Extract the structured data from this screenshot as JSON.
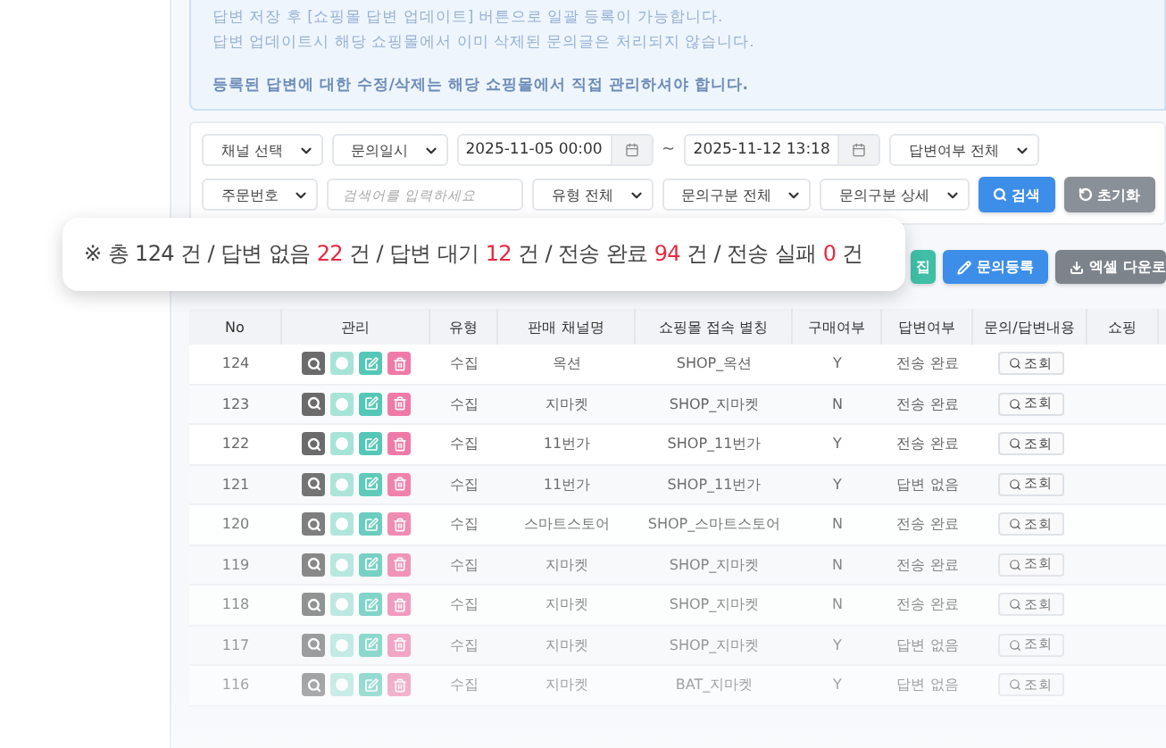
{
  "notice": {
    "lines": [
      "답변 저장 후 [쇼핑몰 답변 업데이트] 버튼으로 일괄 등록이 가능합니다.",
      "답변 업데이트시 해당 쇼핑몰에서 이미 삭제된 문의글은 처리되지 않습니다.",
      "등록된 답변에 대한 수정/삭제는 해당 쇼핑몰에서 직접 관리하셔야 합니다."
    ]
  },
  "filters": {
    "row1": [
      {
        "kind": "select",
        "value": "채널 선택"
      },
      {
        "kind": "select",
        "value": "문의일시"
      },
      {
        "kind": "date",
        "value": "2025-11-05 00:00"
      },
      {
        "kind": "tilde",
        "value": "~"
      },
      {
        "kind": "date",
        "value": "2025-11-12 13:18"
      },
      {
        "kind": "select",
        "value": "답변여부 전체"
      }
    ],
    "row2": [
      {
        "kind": "select",
        "value": "주문번호"
      },
      {
        "kind": "input",
        "placeholder": "검색어를 입력하세요"
      },
      {
        "kind": "select",
        "value": "유형 전체"
      },
      {
        "kind": "select",
        "value": "문의구분 전체"
      },
      {
        "kind": "select",
        "value": "문의구분 상세"
      },
      {
        "kind": "search",
        "value": "검색"
      },
      {
        "kind": "reset",
        "value": "초기화"
      }
    ]
  },
  "actions": [
    {
      "kind": "teal",
      "label": "집"
    },
    {
      "kind": "register",
      "label": "문의등록"
    },
    {
      "kind": "excel",
      "label": "엑셀 다운로"
    }
  ],
  "summary": [
    {
      "label": "※ 총",
      "count": "124",
      "unit": "건",
      "highlight": false
    },
    {
      "label": "/ 답변 없음",
      "count": "22",
      "unit": "건",
      "highlight": true
    },
    {
      "label": "/ 답변 대기",
      "count": "12",
      "unit": "건",
      "highlight": true
    },
    {
      "label": "/ 전송 완료",
      "count": "94",
      "unit": "건",
      "highlight": true
    },
    {
      "label": "/ 전송 실패",
      "count": "0",
      "unit": "건",
      "highlight": true
    }
  ],
  "table": {
    "columns": [
      "No",
      "관리",
      "유형",
      "판매 채널명",
      "쇼핑몰 접속 별칭",
      "구매여부",
      "답변여부",
      "문의/답변내용",
      "쇼핑"
    ],
    "rows": [
      {
        "no": "124",
        "type": "수집",
        "channel": "옥션",
        "alias": "SHOP_옥션",
        "purchased": "Y",
        "status": "전송 완료",
        "view": "조회"
      },
      {
        "no": "123",
        "type": "수집",
        "channel": "지마켓",
        "alias": "SHOP_지마켓",
        "purchased": "N",
        "status": "전송 완료",
        "view": "조회"
      },
      {
        "no": "122",
        "type": "수집",
        "channel": "11번가",
        "alias": "SHOP_11번가",
        "purchased": "Y",
        "status": "전송 완료",
        "view": "조회"
      },
      {
        "no": "121",
        "type": "수집",
        "channel": "11번가",
        "alias": "SHOP_11번가",
        "purchased": "Y",
        "status": "답변 없음",
        "view": "조회"
      },
      {
        "no": "120",
        "type": "수집",
        "channel": "스마트스토어",
        "alias": "SHOP_스마트스토어",
        "purchased": "N",
        "status": "전송 완료",
        "view": "조회"
      },
      {
        "no": "119",
        "type": "수집",
        "channel": "지마켓",
        "alias": "SHOP_지마켓",
        "purchased": "N",
        "status": "전송 완료",
        "view": "조회"
      },
      {
        "no": "118",
        "type": "수집",
        "channel": "지마켓",
        "alias": "SHOP_지마켓",
        "purchased": "N",
        "status": "전송 완료",
        "view": "조회"
      },
      {
        "no": "117",
        "type": "수집",
        "channel": "지마켓",
        "alias": "SHOP_지마켓",
        "purchased": "Y",
        "status": "답변 없음",
        "view": "조회"
      },
      {
        "no": "116",
        "type": "수집",
        "channel": "지마켓",
        "alias": "BAT_지마켓",
        "purchased": "Y",
        "status": "답변 없음",
        "view": "조회"
      }
    ]
  }
}
